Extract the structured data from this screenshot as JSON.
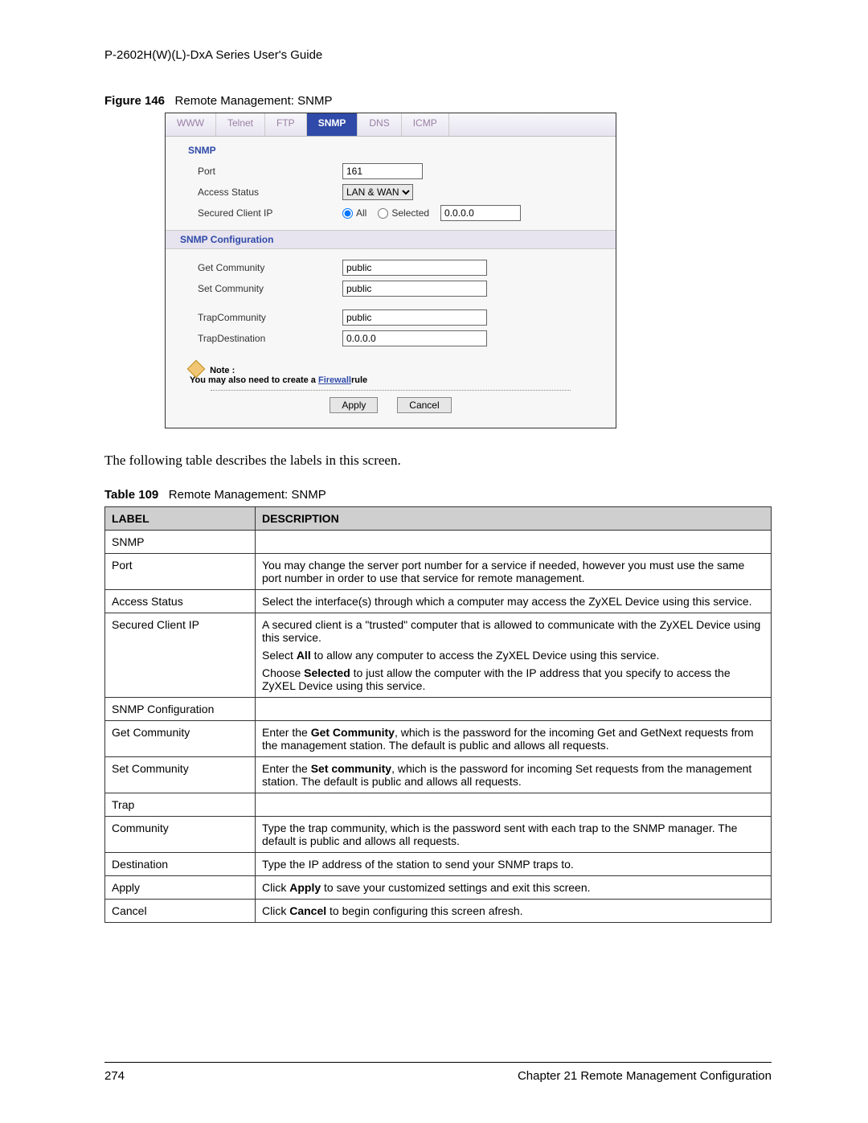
{
  "header": "P-2602H(W)(L)-DxA Series User's Guide",
  "figure": {
    "label": "Figure 146",
    "title": "Remote Management: SNMP"
  },
  "ui": {
    "tabs": [
      "WWW",
      "Telnet",
      "FTP",
      "SNMP",
      "DNS",
      "ICMP"
    ],
    "active_tab": 3,
    "section1_title": "SNMP",
    "port_label": "Port",
    "port_value": "161",
    "access_label": "Access Status",
    "access_value": "LAN & WAN",
    "secured_label": "Secured Client IP",
    "radio_all": "All",
    "radio_selected": "Selected",
    "secured_ip_value": "0.0.0.0",
    "section2_title": "SNMP Configuration",
    "get_comm_label": "Get Community",
    "get_comm_value": "public",
    "set_comm_label": "Set Community",
    "set_comm_value": "public",
    "trap_comm_label": "TrapCommunity",
    "trap_comm_value": "public",
    "trap_dest_label": "TrapDestination",
    "trap_dest_value": "0.0.0.0",
    "note_title": "Note :",
    "note_text_pre": "You may also need to create a ",
    "note_link": "Firewall",
    "note_text_post": "rule",
    "apply_btn": "Apply",
    "cancel_btn": "Cancel"
  },
  "body_text": "The following table describes the labels in this screen.",
  "table_caption": {
    "label": "Table 109",
    "title": "Remote Management: SNMP"
  },
  "table": {
    "head_label": "LABEL",
    "head_desc": "DESCRIPTION",
    "rows": [
      {
        "label": "SNMP",
        "desc": ""
      },
      {
        "label": "Port",
        "desc": "You may change the server port number for a service if needed, however you must use the same port number in order to use that service for remote management."
      },
      {
        "label": "Access Status",
        "desc": "Select the interface(s) through which a computer may access the ZyXEL Device using this service."
      },
      {
        "label": "Secured Client IP",
        "desc_html": "<p>A secured client is a \"trusted\" computer that is allowed to communicate with the ZyXEL Device using this service.</p><p>Select <b>All</b> to allow any computer to access the ZyXEL Device using this service.</p><p>Choose <b>Selected</b> to just allow the computer with the IP address that you specify to access the ZyXEL Device using this service.</p>"
      },
      {
        "label": "SNMP Configuration",
        "desc": ""
      },
      {
        "label": "Get Community",
        "desc_html": "Enter the <b>Get Community</b>, which is the password for the incoming Get and GetNext requests from the management station. The default is public and allows all requests."
      },
      {
        "label": "Set Community",
        "desc_html": "Enter the <b>Set community</b>, which is the password for incoming Set requests from the management station. The default is public and allows all requests."
      },
      {
        "label": "Trap",
        "desc": ""
      },
      {
        "label": "Community",
        "desc": "Type the trap community, which is the password sent with each trap to the SNMP manager. The default is public and allows all requests."
      },
      {
        "label": "Destination",
        "desc": "Type the IP address of the station to send your SNMP traps to."
      },
      {
        "label": "Apply",
        "desc_html": "Click <b>Apply</b> to save your customized settings and exit this screen."
      },
      {
        "label": "Cancel",
        "desc_html": "Click <b>Cancel</b> to begin configuring this screen afresh."
      }
    ]
  },
  "footer": {
    "page": "274",
    "chapter": "Chapter 21 Remote Management Configuration"
  }
}
